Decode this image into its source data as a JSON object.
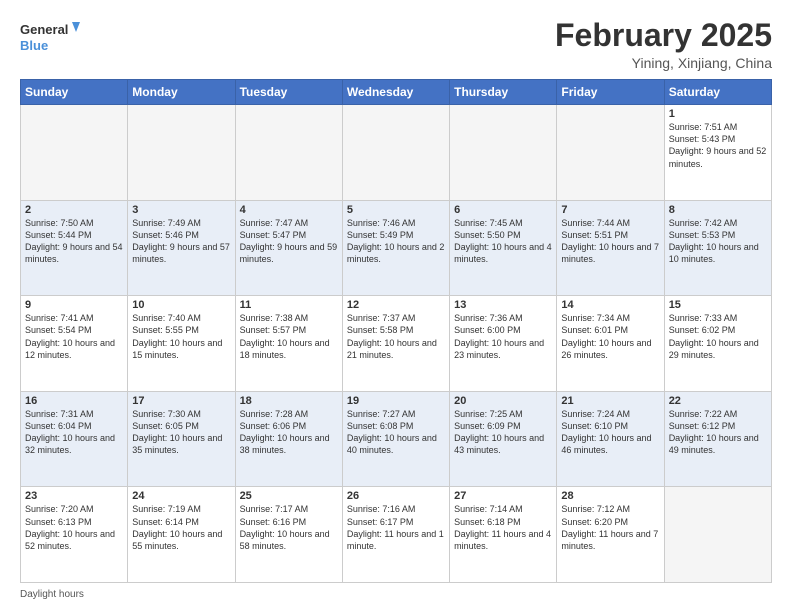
{
  "logo": {
    "text_general": "General",
    "text_blue": "Blue"
  },
  "header": {
    "title": "February 2025",
    "subtitle": "Yining, Xinjiang, China"
  },
  "weekdays": [
    "Sunday",
    "Monday",
    "Tuesday",
    "Wednesday",
    "Thursday",
    "Friday",
    "Saturday"
  ],
  "weeks": [
    [
      {
        "day": "",
        "info": ""
      },
      {
        "day": "",
        "info": ""
      },
      {
        "day": "",
        "info": ""
      },
      {
        "day": "",
        "info": ""
      },
      {
        "day": "",
        "info": ""
      },
      {
        "day": "",
        "info": ""
      },
      {
        "day": "1",
        "info": "Sunrise: 7:51 AM\nSunset: 5:43 PM\nDaylight: 9 hours and 52 minutes."
      }
    ],
    [
      {
        "day": "2",
        "info": "Sunrise: 7:50 AM\nSunset: 5:44 PM\nDaylight: 9 hours and 54 minutes."
      },
      {
        "day": "3",
        "info": "Sunrise: 7:49 AM\nSunset: 5:46 PM\nDaylight: 9 hours and 57 minutes."
      },
      {
        "day": "4",
        "info": "Sunrise: 7:47 AM\nSunset: 5:47 PM\nDaylight: 9 hours and 59 minutes."
      },
      {
        "day": "5",
        "info": "Sunrise: 7:46 AM\nSunset: 5:49 PM\nDaylight: 10 hours and 2 minutes."
      },
      {
        "day": "6",
        "info": "Sunrise: 7:45 AM\nSunset: 5:50 PM\nDaylight: 10 hours and 4 minutes."
      },
      {
        "day": "7",
        "info": "Sunrise: 7:44 AM\nSunset: 5:51 PM\nDaylight: 10 hours and 7 minutes."
      },
      {
        "day": "8",
        "info": "Sunrise: 7:42 AM\nSunset: 5:53 PM\nDaylight: 10 hours and 10 minutes."
      }
    ],
    [
      {
        "day": "9",
        "info": "Sunrise: 7:41 AM\nSunset: 5:54 PM\nDaylight: 10 hours and 12 minutes."
      },
      {
        "day": "10",
        "info": "Sunrise: 7:40 AM\nSunset: 5:55 PM\nDaylight: 10 hours and 15 minutes."
      },
      {
        "day": "11",
        "info": "Sunrise: 7:38 AM\nSunset: 5:57 PM\nDaylight: 10 hours and 18 minutes."
      },
      {
        "day": "12",
        "info": "Sunrise: 7:37 AM\nSunset: 5:58 PM\nDaylight: 10 hours and 21 minutes."
      },
      {
        "day": "13",
        "info": "Sunrise: 7:36 AM\nSunset: 6:00 PM\nDaylight: 10 hours and 23 minutes."
      },
      {
        "day": "14",
        "info": "Sunrise: 7:34 AM\nSunset: 6:01 PM\nDaylight: 10 hours and 26 minutes."
      },
      {
        "day": "15",
        "info": "Sunrise: 7:33 AM\nSunset: 6:02 PM\nDaylight: 10 hours and 29 minutes."
      }
    ],
    [
      {
        "day": "16",
        "info": "Sunrise: 7:31 AM\nSunset: 6:04 PM\nDaylight: 10 hours and 32 minutes."
      },
      {
        "day": "17",
        "info": "Sunrise: 7:30 AM\nSunset: 6:05 PM\nDaylight: 10 hours and 35 minutes."
      },
      {
        "day": "18",
        "info": "Sunrise: 7:28 AM\nSunset: 6:06 PM\nDaylight: 10 hours and 38 minutes."
      },
      {
        "day": "19",
        "info": "Sunrise: 7:27 AM\nSunset: 6:08 PM\nDaylight: 10 hours and 40 minutes."
      },
      {
        "day": "20",
        "info": "Sunrise: 7:25 AM\nSunset: 6:09 PM\nDaylight: 10 hours and 43 minutes."
      },
      {
        "day": "21",
        "info": "Sunrise: 7:24 AM\nSunset: 6:10 PM\nDaylight: 10 hours and 46 minutes."
      },
      {
        "day": "22",
        "info": "Sunrise: 7:22 AM\nSunset: 6:12 PM\nDaylight: 10 hours and 49 minutes."
      }
    ],
    [
      {
        "day": "23",
        "info": "Sunrise: 7:20 AM\nSunset: 6:13 PM\nDaylight: 10 hours and 52 minutes."
      },
      {
        "day": "24",
        "info": "Sunrise: 7:19 AM\nSunset: 6:14 PM\nDaylight: 10 hours and 55 minutes."
      },
      {
        "day": "25",
        "info": "Sunrise: 7:17 AM\nSunset: 6:16 PM\nDaylight: 10 hours and 58 minutes."
      },
      {
        "day": "26",
        "info": "Sunrise: 7:16 AM\nSunset: 6:17 PM\nDaylight: 11 hours and 1 minute."
      },
      {
        "day": "27",
        "info": "Sunrise: 7:14 AM\nSunset: 6:18 PM\nDaylight: 11 hours and 4 minutes."
      },
      {
        "day": "28",
        "info": "Sunrise: 7:12 AM\nSunset: 6:20 PM\nDaylight: 11 hours and 7 minutes."
      },
      {
        "day": "",
        "info": ""
      }
    ]
  ],
  "footer": {
    "daylight_label": "Daylight hours"
  }
}
